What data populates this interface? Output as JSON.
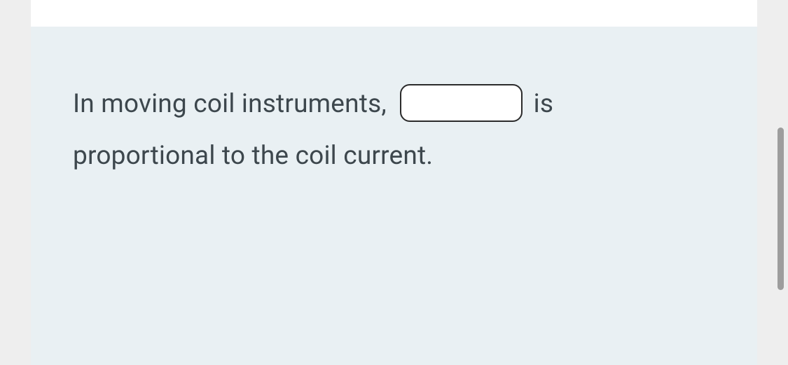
{
  "question": {
    "text_before": "In  moving coil instruments,",
    "text_middle": "is",
    "text_after": "proportional to the coil current.",
    "blank_value": ""
  }
}
